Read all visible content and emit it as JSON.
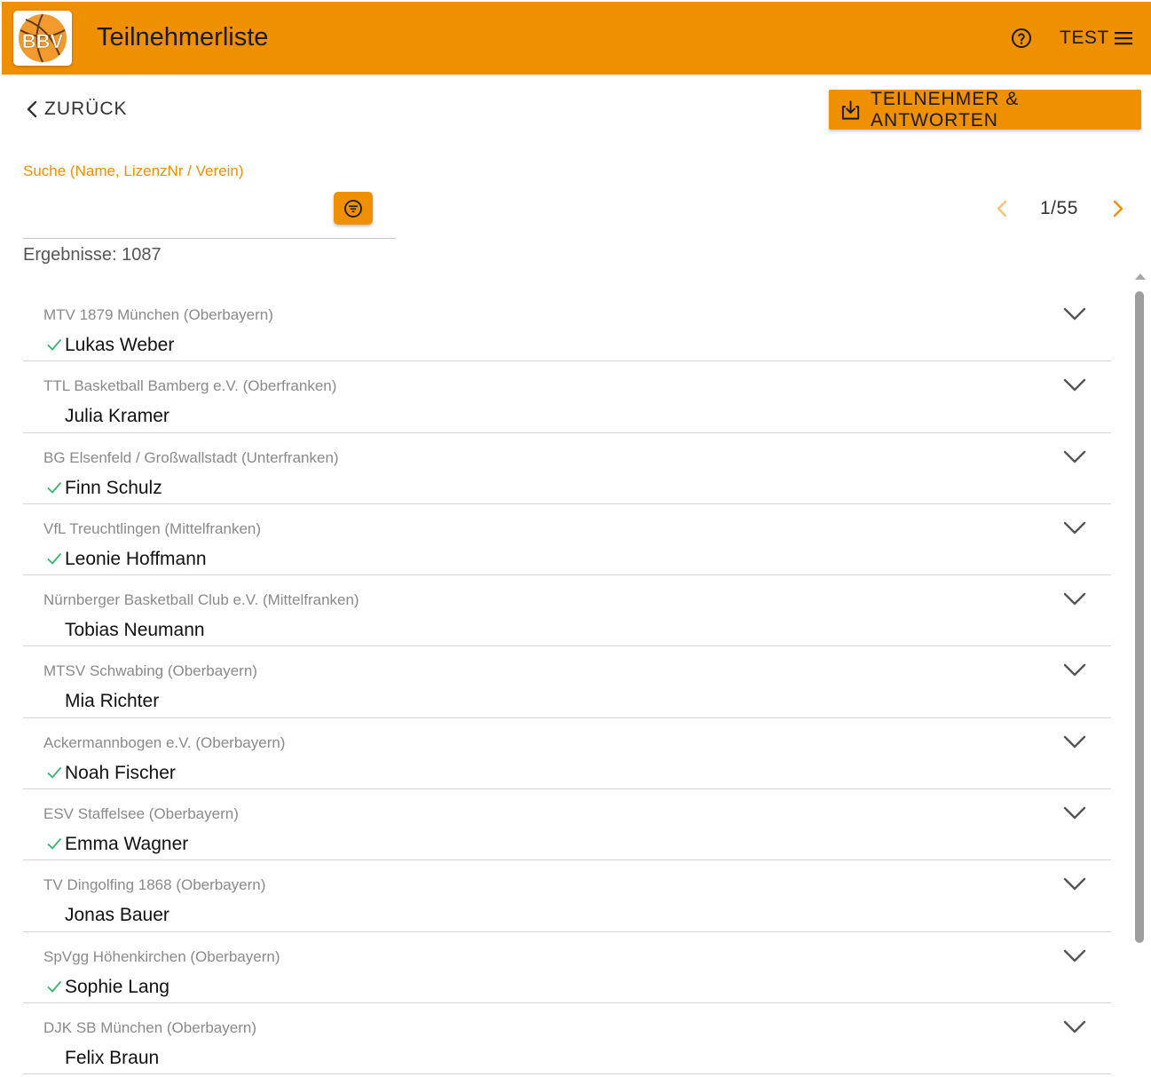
{
  "header": {
    "title": "Teilnehmerliste",
    "logo_text": "BBV",
    "help_icon": "help-circle-icon",
    "user_label": "TEST",
    "menu_icon": "hamburger-menu-icon",
    "accent_color": "#ef9000"
  },
  "toolbar": {
    "back_label": "ZURÜCK",
    "export_label": "TEILNEHMER & ANTWORTEN",
    "export_icon": "download-icon"
  },
  "search": {
    "label": "Suche (Name, LizenzNr / Verein)",
    "value": "",
    "placeholder": "",
    "filter_icon": "filter-icon"
  },
  "pagination": {
    "text": "1/55",
    "current_page": 1,
    "total_pages": 55,
    "prev_enabled": false
  },
  "results": {
    "label": "Ergebnisse: 1087"
  },
  "participants": [
    {
      "club": "MTV 1879 München (Oberbayern)",
      "name": "Lukas Weber",
      "checked": true
    },
    {
      "club": "TTL Basketball Bamberg e.V. (Oberfranken)",
      "name": "Julia Kramer",
      "checked": false
    },
    {
      "club": "BG Elsenfeld / Großwallstadt (Unterfranken)",
      "name": "Finn Schulz",
      "checked": true
    },
    {
      "club": "VfL Treuchtlingen (Mittelfranken)",
      "name": "Leonie Hoffmann",
      "checked": true
    },
    {
      "club": "Nürnberger Basketball Club e.V. (Mittelfranken)",
      "name": "Tobias Neumann",
      "checked": false
    },
    {
      "club": "MTSV Schwabing (Oberbayern)",
      "name": "Mia Richter",
      "checked": false
    },
    {
      "club": "Ackermannbogen e.V. (Oberbayern)",
      "name": "Noah Fischer",
      "checked": true
    },
    {
      "club": "ESV Staffelsee (Oberbayern)",
      "name": "Emma Wagner",
      "checked": true
    },
    {
      "club": "TV Dingolfing 1868 (Oberbayern)",
      "name": "Jonas Bauer",
      "checked": false
    },
    {
      "club": "SpVgg Höhenkirchen (Oberbayern)",
      "name": "Sophie Lang",
      "checked": true
    },
    {
      "club": "DJK SB München (Oberbayern)",
      "name": "Felix Braun",
      "checked": false
    }
  ],
  "colors": {
    "accent": "#ef9000",
    "check": "#3cb371",
    "muted_text": "#8a8a8a"
  }
}
